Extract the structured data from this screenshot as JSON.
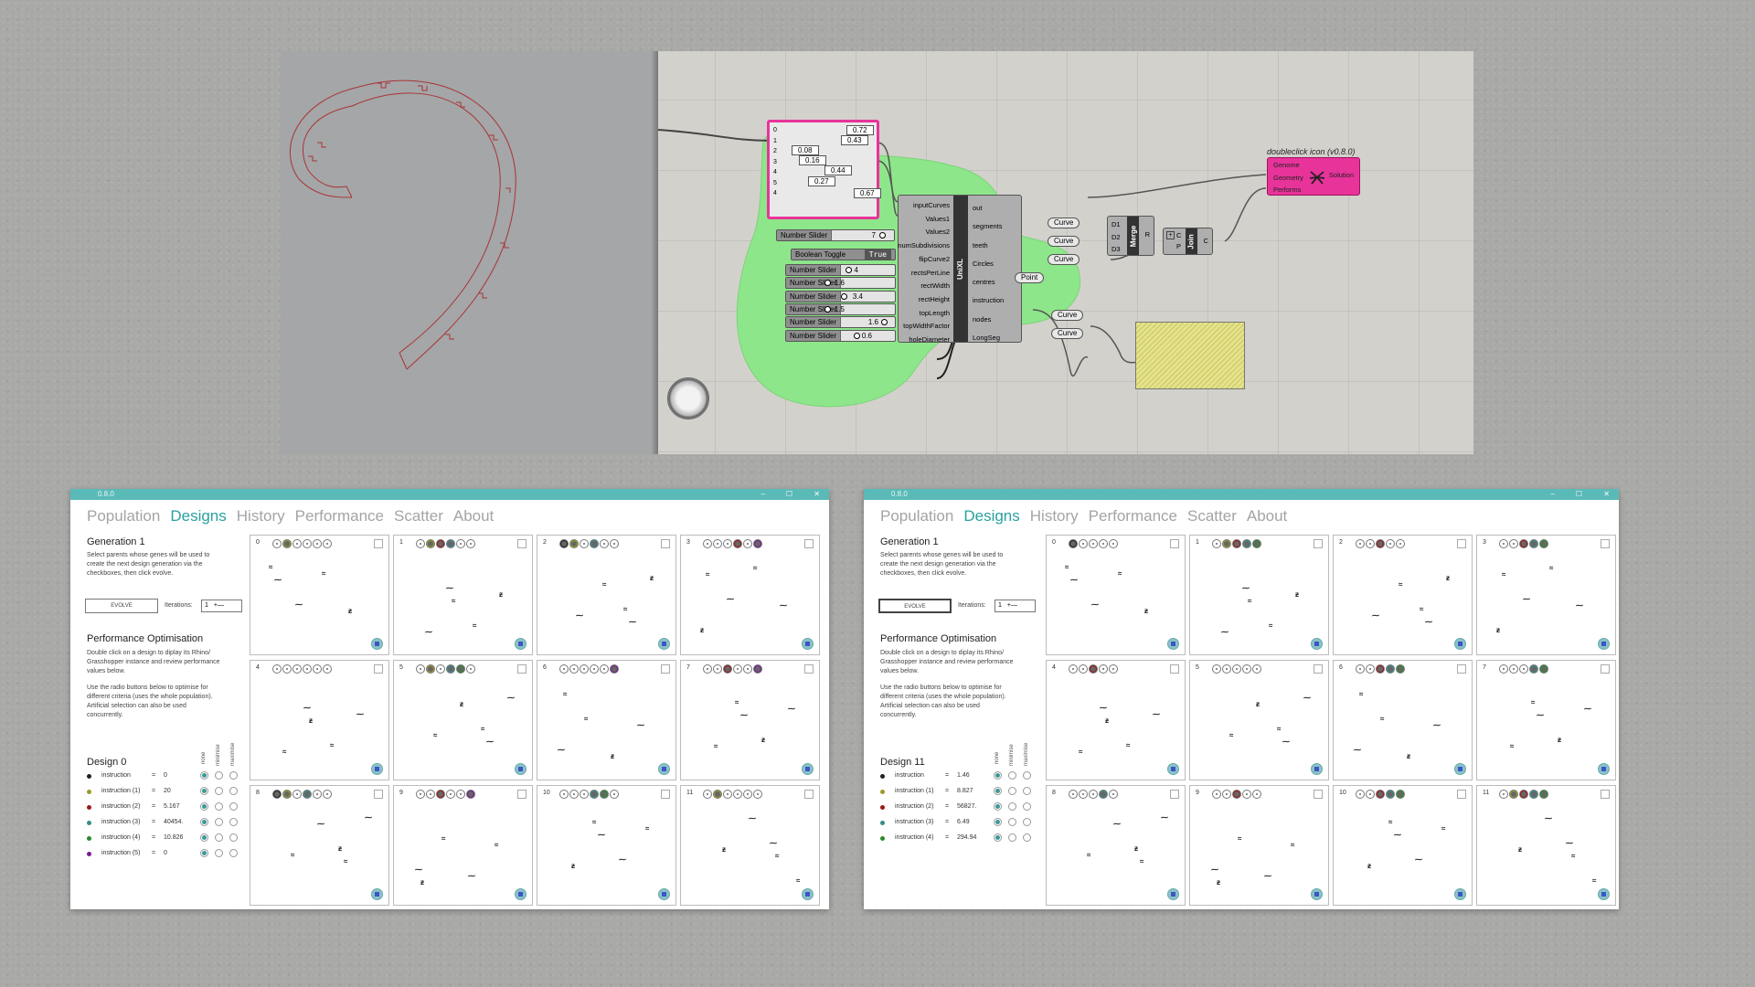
{
  "gh": {
    "graph_rows": [
      "0",
      "1",
      "2",
      "3",
      "4",
      "5",
      "4"
    ],
    "graph_vals": [
      "0.72",
      "0.43",
      "0.08",
      "0.16",
      "0.44",
      "0.27",
      "0.67"
    ],
    "sliders": [
      {
        "label": "Number Slider",
        "value": "7"
      },
      {
        "label": "Number Slider",
        "value": "4"
      },
      {
        "label": "Number Slider",
        "value": "1.6"
      },
      {
        "label": "Number Slider",
        "value": "3.4"
      },
      {
        "label": "Number Slider",
        "value": "1.5"
      },
      {
        "label": "Number Slider",
        "value": "1.6"
      },
      {
        "label": "Number Slider",
        "value": "0.6"
      }
    ],
    "toggle": {
      "label": "Boolean Toggle",
      "value": "True"
    },
    "unixl": {
      "name": "UniXL",
      "inputs": [
        "inputCurves",
        "Values1",
        "Values2",
        "numSubdivisions",
        "flipCurve2",
        "rectsPerLine",
        "rectWidth",
        "rectHeight",
        "topLength",
        "topWidthFactor",
        "holeDiameter"
      ],
      "outputs": [
        "out",
        "segments",
        "teeth",
        "Circles",
        "centres",
        "instruction",
        "nodes",
        "LongSeg"
      ]
    },
    "curve_label": "Curve",
    "point_label": "Point",
    "merge": {
      "name": "Merge",
      "inputs": [
        "D1",
        "D2",
        "D3"
      ],
      "output": "R"
    },
    "join": {
      "name": "Join",
      "inputs": [
        "C",
        "P"
      ],
      "output": "C"
    },
    "biomorpher": {
      "title": "doubleclick icon (v0.8.0)",
      "inputs": [
        "Genome",
        "Geometry",
        "Performs"
      ],
      "output": "Solution"
    }
  },
  "windows": [
    {
      "version": "0.8.0",
      "tabs": [
        "Population",
        "Designs",
        "History",
        "Performance",
        "Scatter",
        "About"
      ],
      "active_tab": "Designs",
      "generation": "Generation 1",
      "gen_desc": [
        "Select parents whose genes will be used to",
        "create the next design generation via the",
        "checkboxes, then click evolve."
      ],
      "evolve": "EVOLVE",
      "iterations_label": "Iterations:",
      "iterations": "1",
      "perf_title": "Performance Optimisation",
      "perf_desc": [
        "Double click on a design to diplay its Rhino/",
        "Grasshopper instance and review performance",
        "values below.",
        "",
        "Use the radio buttons below to optimise for",
        "different criteria (uses the whole population).",
        "Artificial selection can also be used",
        "concurrently."
      ],
      "radio_headers": [
        "none",
        "minimise",
        "maximise"
      ],
      "design_title": "Design 0",
      "perf_rows": [
        {
          "name": "instruction",
          "value": "0",
          "color": "#222222"
        },
        {
          "name": "instruction (1)",
          "value": "20",
          "color": "#9a9a2a"
        },
        {
          "name": "instruction (2)",
          "value": "5.167",
          "color": "#9a1a1a"
        },
        {
          "name": "instruction (3)",
          "value": "40454.",
          "color": "#3a8a8a"
        },
        {
          "name": "instruction (4)",
          "value": "10.826",
          "color": "#2a8a2a"
        },
        {
          "name": "instruction (5)",
          "value": "0",
          "color": "#7a1a9a"
        }
      ],
      "cells": [
        "0",
        "1",
        "2",
        "3",
        "4",
        "5",
        "6",
        "7",
        "8",
        "9",
        "10",
        "11"
      ]
    },
    {
      "version": "0.8.0",
      "tabs": [
        "Population",
        "Designs",
        "History",
        "Performance",
        "Scatter",
        "About"
      ],
      "active_tab": "Designs",
      "generation": "Generation 1",
      "gen_desc": [
        "Select parents whose genes will be used to",
        "create the next design generation via the",
        "checkboxes, then click evolve."
      ],
      "evolve": "EVOLVE",
      "iterations_label": "Iterations:",
      "iterations": "1",
      "perf_title": "Performance Optimisation",
      "perf_desc": [
        "Double click on a design to diplay its Rhino/",
        "Grasshopper instance and review performance",
        "values below.",
        "",
        "Use the radio buttons below to optimise for",
        "different criteria (uses the whole population).",
        "Artificial selection can also be used",
        "concurrently."
      ],
      "radio_headers": [
        "none",
        "minimise",
        "maximise"
      ],
      "design_title": "Design 11",
      "perf_rows": [
        {
          "name": "instruction",
          "value": "1.46",
          "color": "#222222"
        },
        {
          "name": "instruction (1)",
          "value": "8.827",
          "color": "#9a9a2a"
        },
        {
          "name": "instruction (2)",
          "value": "56827.",
          "color": "#9a1a1a"
        },
        {
          "name": "instruction (3)",
          "value": "6.49",
          "color": "#3a8a8a"
        },
        {
          "name": "instruction (4)",
          "value": "294.94",
          "color": "#2a8a2a"
        }
      ],
      "cells": [
        "0",
        "1",
        "2",
        "3",
        "4",
        "5",
        "6",
        "7",
        "8",
        "9",
        "10",
        "11"
      ]
    }
  ],
  "colors": {
    "accent": "#5abab8",
    "tab_active": "#2aa0a0",
    "group_green": "#8ee68a",
    "biomorpher_pink": "#e8339a",
    "panel_yellow": "#e5e38a"
  },
  "icons": [
    "settings-dial-icon",
    "biomorpher-icon",
    "display-design-icon",
    "minimize-icon",
    "maximize-icon",
    "close-icon"
  ]
}
